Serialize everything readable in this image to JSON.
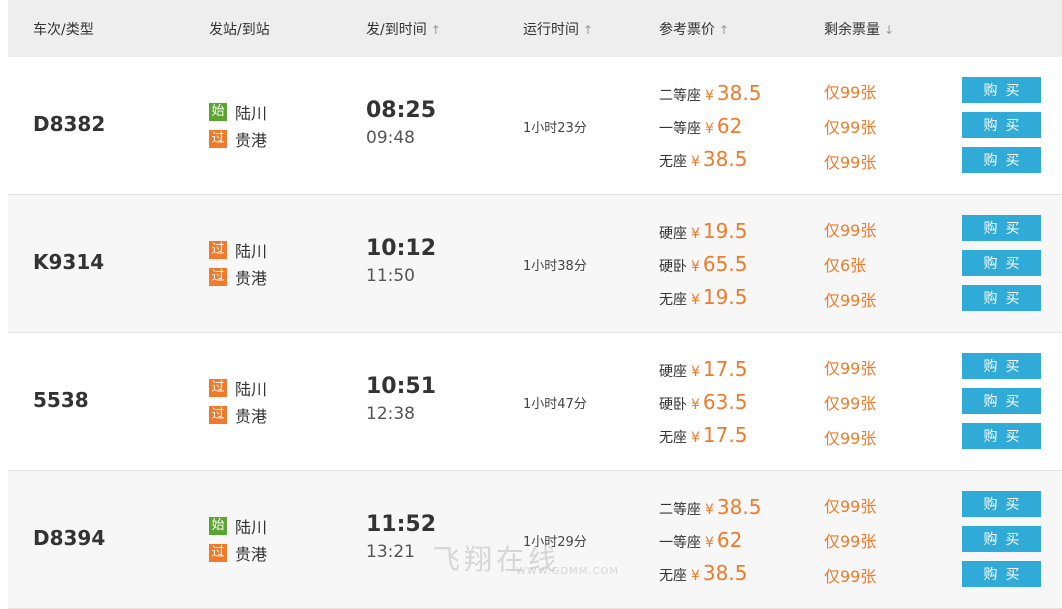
{
  "header": {
    "train": "车次/类型",
    "station": "发站/到站",
    "time": "发/到时间",
    "time_arrow": "↑",
    "duration": "运行时间",
    "duration_arrow": "↑",
    "price": "参考票价",
    "price_arrow": "↑",
    "remain": "剩余票量",
    "remain_arrow": "↓"
  },
  "rows": [
    {
      "train": "D8382",
      "from_tag": "始",
      "from": "陆川",
      "to_tag": "过",
      "to": "贵港",
      "dep": "08:25",
      "arr": "09:48",
      "duration": "1小时23分",
      "seats": [
        {
          "name": "二等座",
          "yen": "¥",
          "price": "38.5",
          "remain": "仅99张",
          "buy": "购买"
        },
        {
          "name": "一等座",
          "yen": "¥",
          "price": "62",
          "remain": "仅99张",
          "buy": "购买"
        },
        {
          "name": "无座",
          "yen": "¥",
          "price": "38.5",
          "remain": "仅99张",
          "buy": "购买"
        }
      ]
    },
    {
      "train": "K9314",
      "from_tag": "过",
      "from": "陆川",
      "to_tag": "过",
      "to": "贵港",
      "dep": "10:12",
      "arr": "11:50",
      "duration": "1小时38分",
      "seats": [
        {
          "name": "硬座",
          "yen": "¥",
          "price": "19.5",
          "remain": "仅99张",
          "buy": "购买"
        },
        {
          "name": "硬卧",
          "yen": "¥",
          "price": "65.5",
          "remain": "仅6张",
          "buy": "购买"
        },
        {
          "name": "无座",
          "yen": "¥",
          "price": "19.5",
          "remain": "仅99张",
          "buy": "购买"
        }
      ]
    },
    {
      "train": "5538",
      "from_tag": "过",
      "from": "陆川",
      "to_tag": "过",
      "to": "贵港",
      "dep": "10:51",
      "arr": "12:38",
      "duration": "1小时47分",
      "seats": [
        {
          "name": "硬座",
          "yen": "¥",
          "price": "17.5",
          "remain": "仅99张",
          "buy": "购买"
        },
        {
          "name": "硬卧",
          "yen": "¥",
          "price": "63.5",
          "remain": "仅99张",
          "buy": "购买"
        },
        {
          "name": "无座",
          "yen": "¥",
          "price": "17.5",
          "remain": "仅99张",
          "buy": "购买"
        }
      ]
    },
    {
      "train": "D8394",
      "from_tag": "始",
      "from": "陆川",
      "to_tag": "过",
      "to": "贵港",
      "dep": "11:52",
      "arr": "13:21",
      "duration": "1小时29分",
      "seats": [
        {
          "name": "二等座",
          "yen": "¥",
          "price": "38.5",
          "remain": "仅99张",
          "buy": "购买"
        },
        {
          "name": "一等座",
          "yen": "¥",
          "price": "62",
          "remain": "仅99张",
          "buy": "购买"
        },
        {
          "name": "无座",
          "yen": "¥",
          "price": "38.5",
          "remain": "仅99张",
          "buy": "购买"
        }
      ]
    }
  ],
  "watermark": {
    "logo": "飞翔在线",
    "url": "WWW.GDMM.COM"
  },
  "colors": {
    "accent_price": "#f07a2a",
    "buy_button": "#30aad6",
    "tag_start": "#5aa532",
    "tag_pass": "#f07a2a",
    "header_bg": "#eeeeee"
  }
}
